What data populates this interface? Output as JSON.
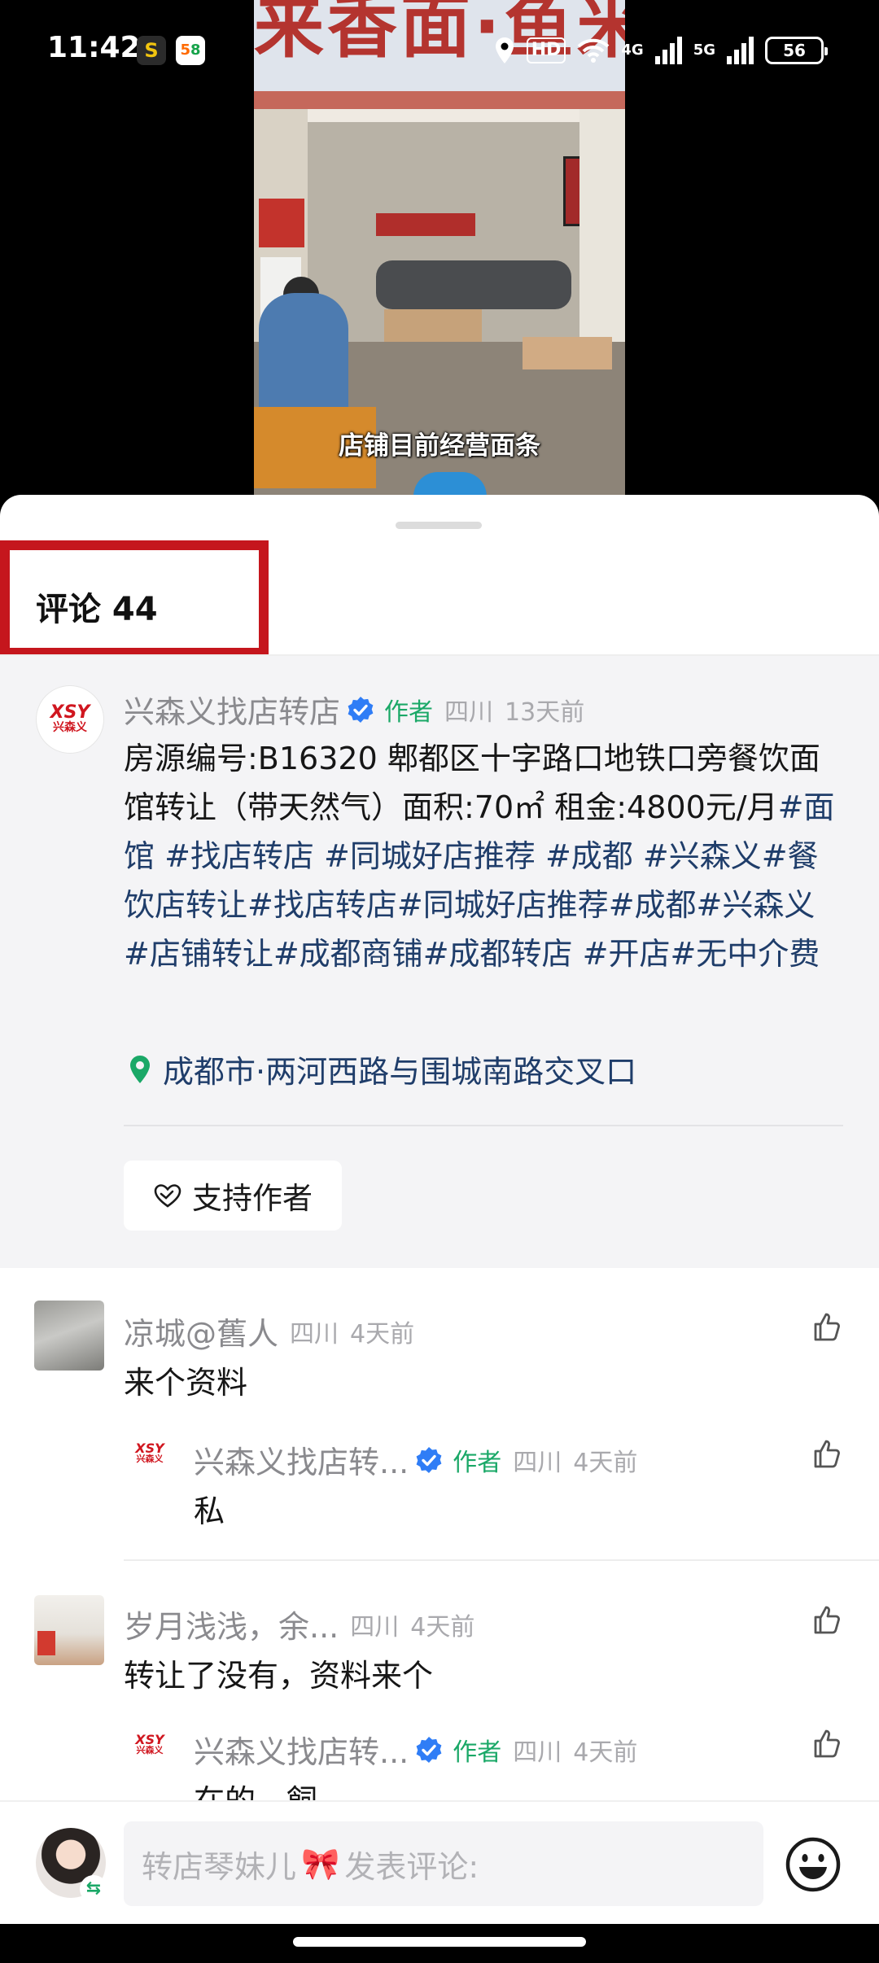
{
  "status_bar": {
    "time": "11:42",
    "app_icon_1": "S",
    "app_icon_2": [
      "5",
      "8"
    ],
    "hd_label": "HD",
    "net_4g": "4G",
    "net_5g": "5G",
    "battery": "56",
    "icons": [
      "location-icon",
      "wifi-icon",
      "signal-icon"
    ]
  },
  "video": {
    "sign_text": "来香面·鱼米",
    "caption": "店铺目前经营面条"
  },
  "comments_header": {
    "title": "评论 44"
  },
  "pinned_post": {
    "avatar_logo_top": "XSY",
    "avatar_logo_bottom": "兴森义",
    "user_name": "兴森义找店转店",
    "author_tag": "作者",
    "region": "四川",
    "time_ago": "13天前",
    "text_plain": "房源编号:B16320 郫都区十字路口地铁口旁餐饮面馆转让（带天然气）面积:70㎡  租金:4800元/月",
    "hashtags": [
      "#面馆",
      " #找店转店",
      " #同城好店推荐",
      " #成都",
      " #兴森义",
      "#餐饮店转让",
      "#找店转店",
      "#同城好店推荐",
      "#成都",
      "#兴森义",
      "#店铺转让",
      "#成都商铺",
      "#成都转店",
      " #开店",
      "#无中介费"
    ],
    "location": "成都市·两河西路与围城南路交叉口",
    "support_label": "支持作者"
  },
  "comments": [
    {
      "user_name": "凉城@舊人",
      "region": "四川",
      "time_ago": "4天前",
      "text": "来个资料",
      "replies": [
        {
          "user_name": "兴森义找店转...",
          "author_tag": "作者",
          "region": "四川",
          "time_ago": "4天前",
          "text": "私"
        }
      ]
    },
    {
      "user_name": "岁月浅浅，余...",
      "region": "四川",
      "time_ago": "4天前",
      "text": "转让了没有，资料来个",
      "replies": [
        {
          "user_name": "兴森义找店转...",
          "author_tag": "作者",
          "region": "四川",
          "time_ago": "4天前",
          "text": "在的，飼"
        }
      ]
    }
  ],
  "input_bar": {
    "placeholder_name": "转店琴妹儿",
    "placeholder_bow": "🎀",
    "placeholder_action": "发表评论:"
  },
  "colors": {
    "accent_author": "#1aa867",
    "hashtag": "#1f3d6a",
    "verified": "#2f7df6",
    "header_highlight_border": "#c5161d",
    "pinned_background": "#f4f4f6"
  }
}
